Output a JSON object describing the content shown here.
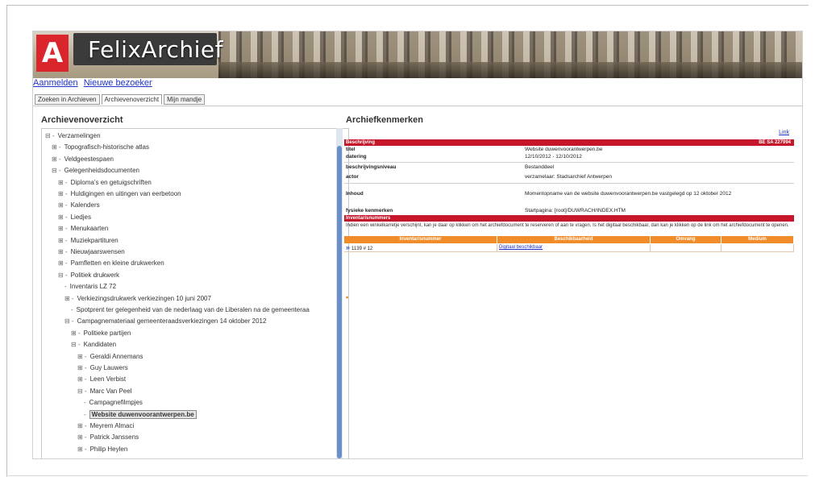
{
  "app": {
    "logo_letter": "A",
    "logo_text": "FelixArchief"
  },
  "toplinks": [
    "Aanmelden",
    "Nieuwe bezoeker"
  ],
  "tabs": [
    {
      "label": "Zoeken in Archieven",
      "active": false
    },
    {
      "label": "Archievenoverzicht",
      "active": true
    },
    {
      "label": "Mijn mandje",
      "active": false
    }
  ],
  "left_title": "Archievenoverzicht",
  "right_title": "Archiefkenmerken",
  "tree": [
    {
      "label": "Verzamelingen",
      "exp": "⊟ -",
      "indent": 0
    },
    {
      "label": "Topografisch-historische atlas",
      "exp": "⊞ -",
      "indent": 1
    },
    {
      "label": "Veldgeestespaen",
      "exp": "⊞ -",
      "indent": 1
    },
    {
      "label": "Gelegenheidsdocumenten",
      "exp": "⊟ -",
      "indent": 1
    },
    {
      "label": "Diploma's en getuigschriften",
      "exp": "⊞ -",
      "indent": 2
    },
    {
      "label": "Huldigingen en uitingen van eerbetoon",
      "exp": "⊞ -",
      "indent": 2
    },
    {
      "label": "Kalenders",
      "exp": "⊞ -",
      "indent": 2
    },
    {
      "label": "Liedjes",
      "exp": "⊞ -",
      "indent": 2
    },
    {
      "label": "Menukaarten",
      "exp": "⊞ -",
      "indent": 2
    },
    {
      "label": "Muziekpartituren",
      "exp": "⊞ -",
      "indent": 2
    },
    {
      "label": "Nieuwjaarswensen",
      "exp": "⊞ -",
      "indent": 2
    },
    {
      "label": "Pamfletten en kleine drukwerken",
      "exp": "⊞ -",
      "indent": 2
    },
    {
      "label": "Politiek drukwerk",
      "exp": "⊟ -",
      "indent": 2
    },
    {
      "label": "Inventaris LZ 72",
      "exp": "-",
      "indent": 3
    },
    {
      "label": "Verkiezingsdrukwerk verkiezingen 10 juni 2007",
      "exp": "⊞ -",
      "indent": 3
    },
    {
      "label": "Spotprent ter gelegenheid van de nederlaag van de Liberalen na de gemeenteraa",
      "exp": "-",
      "indent": 4
    },
    {
      "label": "Campagnemateriaal gemeenteraadsverkiezingen 14 oktober 2012",
      "exp": "⊟ -",
      "indent": 3
    },
    {
      "label": "Politieke partijen",
      "exp": "⊞ -",
      "indent": 4
    },
    {
      "label": "Kandidaten",
      "exp": "⊟ -",
      "indent": 4
    },
    {
      "label": "Geraldi Annemans",
      "exp": "⊞ -",
      "indent": 5
    },
    {
      "label": "Guy Lauwers",
      "exp": "⊞ -",
      "indent": 5
    },
    {
      "label": "Leen Verbist",
      "exp": "⊞ -",
      "indent": 5
    },
    {
      "label": "Marc Van Peel",
      "exp": "⊟ -",
      "indent": 5
    },
    {
      "label": "Campagnefilmpjes",
      "exp": "-",
      "indent": 6
    },
    {
      "label": "Website duwenvoorantwerpen.be",
      "exp": "-",
      "indent": 6,
      "selected": true
    },
    {
      "label": "Meyrem Almaci",
      "exp": "⊞ -",
      "indent": 5
    },
    {
      "label": "Patrick Janssens",
      "exp": "⊞ -",
      "indent": 5
    },
    {
      "label": "Philip Heylen",
      "exp": "⊞ -",
      "indent": 5
    }
  ],
  "details": {
    "link_top": "Link",
    "section1": "Beschrijving",
    "section1_right": "BE SA 227994",
    "fields": [
      {
        "k": "titel",
        "v": "Website duwenvoorantwerpen.be"
      },
      {
        "k": "datering",
        "v": "12/10/2012 - 12/10/2012"
      },
      {
        "k": "beschrijvingsniveau",
        "v": "Bestanddeel"
      },
      {
        "k": "actor",
        "v": "verzamelaar: Stadsarchief Antwerpen"
      }
    ],
    "inhoud_k": "Inhoud",
    "inhoud_v": "Momentopname van de website duwenvoorantwerpen.be vastgelegd op 12 oktober 2012",
    "fysiek_k": "fysieke kenmerken",
    "fysiek_v": "Startpagina: [root]/DUWRACH/INDEX.HTM",
    "section2": "Inventarisnummers",
    "info": "Indien een winkelkarretje verschijnt, kan je daar op klikken om het archiefdocument te reserveren of aan te vragen. Is het digitaal beschikbaar, dan kan je klikken op de link om het archiefdocument te openen.",
    "table_headers": [
      "Inventarisnummer",
      "Beschikbaarheid",
      "Omvang",
      "Medium"
    ],
    "table_row": [
      "1139 # 12",
      "Digitaal beschikbaar",
      "",
      ""
    ]
  },
  "colors": {
    "red": "#c5162b",
    "orange": "#f08c2a",
    "link": "#2033c8"
  }
}
